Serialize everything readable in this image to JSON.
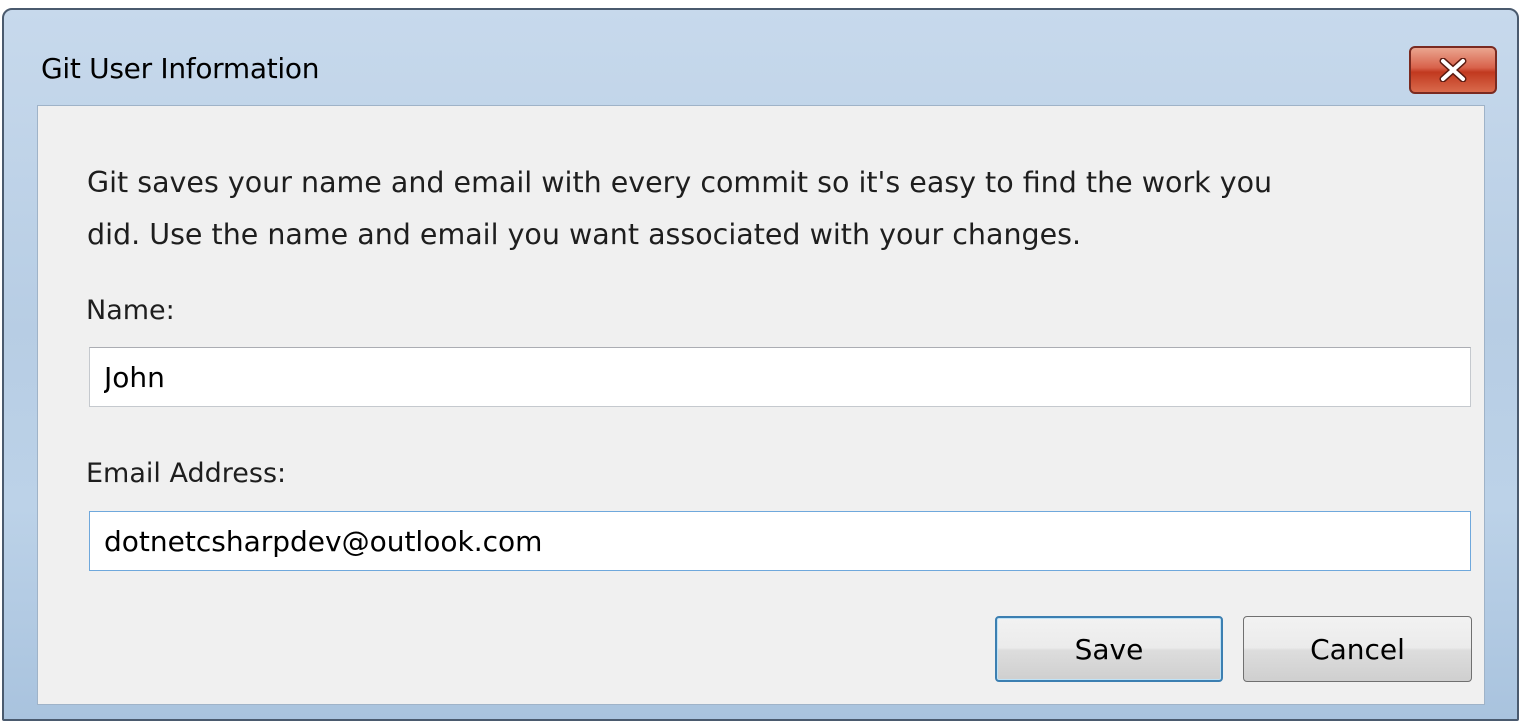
{
  "window": {
    "title": "Git User Information",
    "close_icon": "close-icon"
  },
  "form": {
    "description_line1": "Git saves your name and email with every commit so it's easy to find the work you",
    "description_line2": "did. Use the name and email you want associated with your changes.",
    "name_label": "Name:",
    "name_value": "John",
    "email_label": "Email Address:",
    "email_value": "dotnetcsharpdev@outlook.com"
  },
  "buttons": {
    "save_label": "Save",
    "cancel_label": "Cancel"
  },
  "colors": {
    "close_button": "#c8432c",
    "title_bar": "#bfd3e8",
    "client_bg": "#f0f0f0",
    "focus_border": "#6fa8dc"
  }
}
